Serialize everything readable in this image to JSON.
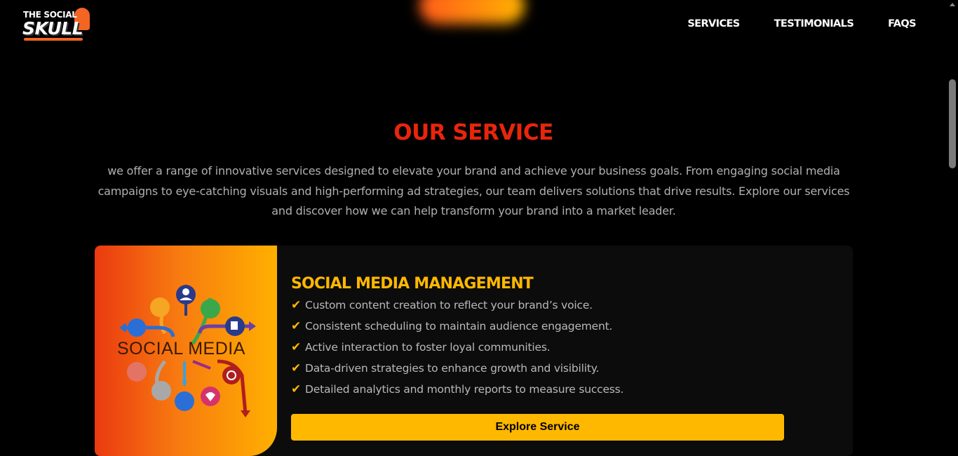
{
  "brand": {
    "line1": "THE SOCIAL",
    "line2": "SKULL"
  },
  "nav": {
    "items": [
      "SERVICES",
      "TESTIMONIALS",
      "FAQS"
    ]
  },
  "section": {
    "title": "OUR SERVICE",
    "intro": "we offer a range of innovative services designed to elevate your brand and achieve your business goals. From engaging social media campaigns to eye-catching visuals and high-performing ad strategies, our team delivers solutions that drive results. Explore our services and discover how we can help transform your brand into a market leader."
  },
  "service_card": {
    "image_text": "SOCIAL MEDIA",
    "title": "SOCIAL MEDIA MANAGEMENT",
    "check_glyph": "✔",
    "features": [
      "Custom content creation to reflect your brand’s voice.",
      "Consistent scheduling to maintain audience engagement.",
      "Active interaction to foster loyal communities.",
      "Data-driven strategies to enhance growth and visibility.",
      "Detailed analytics and monthly reports to measure success."
    ],
    "button_label": "Explore Service"
  },
  "colors": {
    "accent_red": "#e8250c",
    "accent_gold": "#ffb800",
    "background": "#000000",
    "card_background": "#0c0c0c"
  }
}
